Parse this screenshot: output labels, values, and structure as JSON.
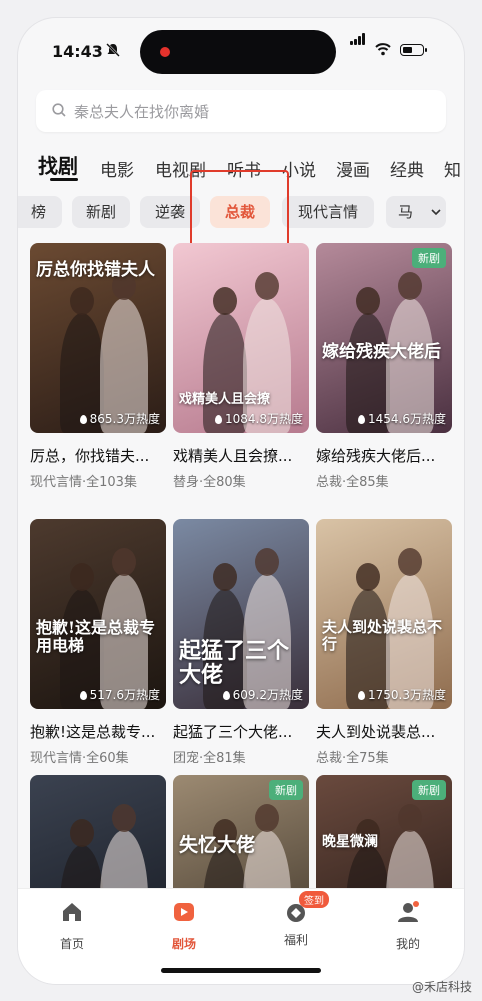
{
  "status_bar": {
    "time": "14:43"
  },
  "search": {
    "placeholder": "秦总夫人在找你离婚"
  },
  "top_tabs": [
    {
      "label": "找剧",
      "active": true
    },
    {
      "label": "电影"
    },
    {
      "label": "电视剧"
    },
    {
      "label": "听书"
    },
    {
      "label": "小说"
    },
    {
      "label": "漫画"
    },
    {
      "label": "经典"
    },
    {
      "label": "知"
    }
  ],
  "chips": [
    {
      "label": "榜"
    },
    {
      "label": "新剧"
    },
    {
      "label": "逆袭"
    },
    {
      "label": "总裁",
      "active": true
    },
    {
      "label": "现代言情"
    },
    {
      "label": "马"
    }
  ],
  "dramas": [
    {
      "poster_title": "厉总你找错夫人",
      "title": "厉总，你找错夫...",
      "meta": "现代言情·全103集",
      "heat": "865.3万热度",
      "new": "",
      "colors": [
        "#6b4a32",
        "#2b1d17"
      ]
    },
    {
      "poster_title": "戏精美人且会撩",
      "title": "戏精美人且会撩...",
      "meta": "替身·全80集",
      "heat": "1084.8万热度",
      "new": "",
      "colors": [
        "#f2c8d2",
        "#b67a8e"
      ]
    },
    {
      "poster_title": "嫁给残疾大佬后",
      "title": "嫁给残疾大佬后...",
      "meta": "总裁·全85集",
      "heat": "1454.6万热度",
      "new": "新剧",
      "colors": [
        "#b58a9a",
        "#4a3040"
      ]
    },
    {
      "poster_title": "抱歉!这是总裁专用电梯",
      "title": "抱歉!这是总裁专...",
      "meta": "现代言情·全60集",
      "heat": "517.6万热度",
      "new": "",
      "colors": [
        "#4d3a2e",
        "#1c1510"
      ]
    },
    {
      "poster_title": "起猛了三个大佬",
      "title": "起猛了三个大佬...",
      "meta": "团宠·全81集",
      "heat": "609.2万热度",
      "new": "",
      "colors": [
        "#7b8aa3",
        "#3a2f3a"
      ]
    },
    {
      "poster_title": "夫人到处说裴总不行",
      "title": "夫人到处说裴总...",
      "meta": "总裁·全75集",
      "heat": "1750.3万热度",
      "new": "",
      "colors": [
        "#d9c3a6",
        "#8f6c4e"
      ]
    },
    {
      "poster_title": "",
      "title": "",
      "meta": "",
      "heat": "",
      "new": "",
      "colors": [
        "#3b4250",
        "#161a22"
      ]
    },
    {
      "poster_title": "失忆大佬",
      "title": "",
      "meta": "",
      "heat": "",
      "new": "新剧",
      "colors": [
        "#9c8a72",
        "#3e3428"
      ]
    },
    {
      "poster_title": "晚星微澜",
      "title": "",
      "meta": "",
      "heat": "",
      "new": "新剧",
      "colors": [
        "#6a4a3e",
        "#241814"
      ]
    }
  ],
  "bottom_nav": [
    {
      "label": "首页",
      "icon": "home-icon"
    },
    {
      "label": "剧场",
      "icon": "theater-icon",
      "active": true
    },
    {
      "label": "福利",
      "icon": "gift-icon",
      "badge": "签到"
    },
    {
      "label": "我的",
      "icon": "profile-icon"
    }
  ],
  "watermark": "@禾店科技",
  "accent": "#e2563a"
}
